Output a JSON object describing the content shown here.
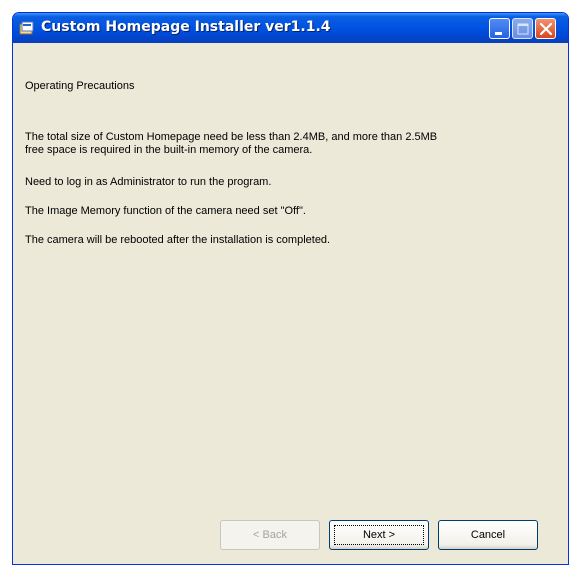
{
  "window": {
    "title": "Custom Homepage Installer ver1.1.4"
  },
  "content": {
    "heading": "Operating Precautions",
    "paragraphs": [
      "The total size of Custom Homepage need be less than 2.4MB, and more than 2.5MB\n free space is required in the built-in memory of the camera.",
      "Need to log in as Administrator to run the program.",
      "The Image Memory function of the camera need set \"Off\".",
      "The camera will be rebooted after the installation is completed."
    ]
  },
  "buttons": {
    "back": "< Back",
    "next": "Next >",
    "cancel": "Cancel"
  },
  "colors": {
    "titlebar": "#0054e3",
    "dialog_bg": "#ece9d8",
    "close_button": "#d9461e"
  },
  "icons": {
    "app": "app-icon",
    "minimize": "minimize-icon",
    "maximize": "maximize-icon",
    "close": "close-icon"
  }
}
